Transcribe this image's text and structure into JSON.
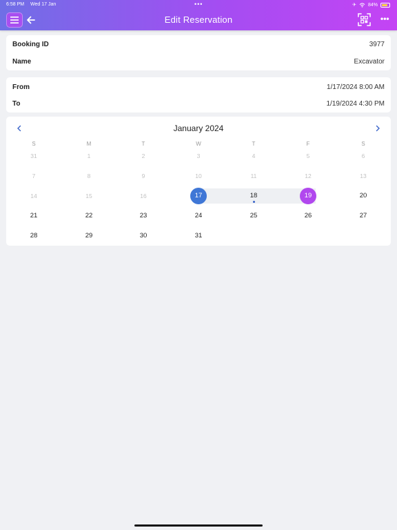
{
  "status_bar": {
    "time": "6:58 PM",
    "date": "Wed 17 Jan",
    "battery": "84%"
  },
  "header": {
    "title": "Edit Reservation"
  },
  "booking": {
    "id_label": "Booking ID",
    "id_value": "3977",
    "name_label": "Name",
    "name_value": "Excavator"
  },
  "dates": {
    "from_label": "From",
    "from_value": "1/17/2024 8:00 AM",
    "to_label": "To",
    "to_value": "1/19/2024 4:30 PM"
  },
  "calendar": {
    "month_title": "January 2024",
    "weekdays": [
      "S",
      "M",
      "T",
      "W",
      "T",
      "F",
      "S"
    ],
    "weeks": [
      [
        "31",
        "1",
        "2",
        "3",
        "4",
        "5",
        "6"
      ],
      [
        "7",
        "8",
        "9",
        "10",
        "11",
        "12",
        "13"
      ],
      [
        "14",
        "15",
        "16",
        "17",
        "18",
        "19",
        "20"
      ],
      [
        "21",
        "22",
        "23",
        "24",
        "25",
        "26",
        "27"
      ],
      [
        "28",
        "29",
        "30",
        "31",
        "",
        "",
        ""
      ]
    ],
    "range_start": "17",
    "range_end": "19",
    "today": "18",
    "colors": {
      "range_start": "#3f77d6",
      "range_end": "#b148ee",
      "accent": "#3a64c9"
    }
  }
}
